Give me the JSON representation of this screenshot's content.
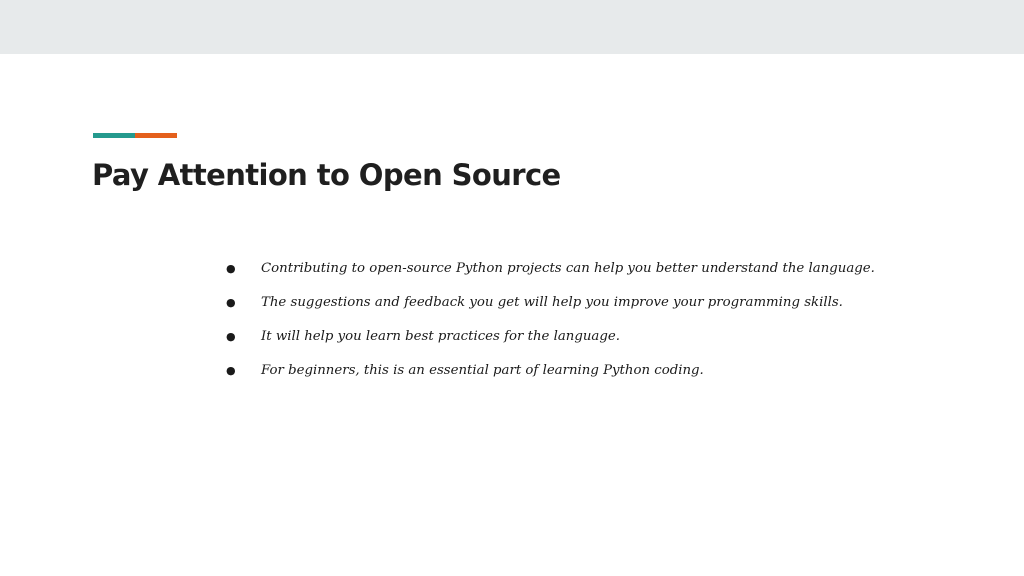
{
  "slide": {
    "title": "Pay Attention to Open Source",
    "accent_colors": [
      "#259a8e",
      "#e4601c"
    ],
    "bullets": [
      " Contributing to open-source Python projects can help you better understand the language.",
      "The suggestions and feedback you get will help you improve your programming skills.",
      "It will help you learn best practices for the language.",
      " For beginners, this is an essential part of learning Python coding."
    ],
    "bullet_glyph": "●"
  }
}
